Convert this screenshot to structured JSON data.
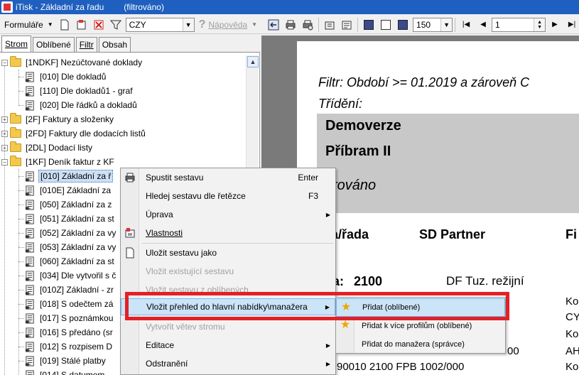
{
  "window": {
    "title": "iTisk - Základní za řadu",
    "filter_state": "(filtrováno)"
  },
  "toolbar": {
    "forms_label": "Formuláře",
    "currency_value": "CZY",
    "help_label": "Nápověda",
    "zoom_value": "150",
    "page_value": "1"
  },
  "tabs": [
    {
      "label": "Strom",
      "active": true
    },
    {
      "label": "Oblíbené",
      "active": false
    },
    {
      "label": "Filtr",
      "active": false
    },
    {
      "label": "Obsah",
      "active": false
    }
  ],
  "tree": {
    "items": [
      {
        "label": "[1NDKF]  Nezúčtované doklady",
        "kind": "folder",
        "level": 0,
        "expanded": true
      },
      {
        "label": "[010] Dle dokladů",
        "kind": "report",
        "level": 1
      },
      {
        "label": "[110] Dle dokladů1 - graf",
        "kind": "report",
        "level": 1
      },
      {
        "label": "[020] Dle řádků a dokladů",
        "kind": "report",
        "level": 1
      },
      {
        "label": "[2F]  Faktury a složenky",
        "kind": "folder",
        "level": 0,
        "expanded": false
      },
      {
        "label": "[2FD]  Faktury dle dodacích listů",
        "kind": "folder",
        "level": 0,
        "expanded": false
      },
      {
        "label": "[2DL]  Dodací listy",
        "kind": "folder",
        "level": 0,
        "expanded": false
      },
      {
        "label": "[1KF]  Deník faktur z KF",
        "kind": "folder",
        "level": 0,
        "expanded": true
      },
      {
        "label": "[010] Základní za ř",
        "kind": "report",
        "level": 1,
        "selected": true
      },
      {
        "label": "[010E] Základní za",
        "kind": "report",
        "level": 1
      },
      {
        "label": "[050] Základní za z",
        "kind": "report",
        "level": 1
      },
      {
        "label": "[051] Základní za st",
        "kind": "report",
        "level": 1
      },
      {
        "label": "[052] Základní za vy",
        "kind": "report",
        "level": 1
      },
      {
        "label": "[053] Základní za vy",
        "kind": "report",
        "level": 1
      },
      {
        "label": "[060] Základní za st",
        "kind": "report",
        "level": 1
      },
      {
        "label": "[034] Dle vytvořil s č",
        "kind": "report",
        "level": 1
      },
      {
        "label": "[010Z] Základní - zr",
        "kind": "report",
        "level": 1
      },
      {
        "label": "[018] S odečtem zá",
        "kind": "report",
        "level": 1
      },
      {
        "label": "[017] S poznámkou",
        "kind": "report",
        "level": 1
      },
      {
        "label": "[016] S předáno (sr",
        "kind": "report",
        "level": 1
      },
      {
        "label": "[012] S rozpisem D",
        "kind": "report",
        "level": 1
      },
      {
        "label": "[019] Stálé platby",
        "kind": "report",
        "level": 1
      },
      {
        "label": "[014] S datumem",
        "kind": "report",
        "level": 1
      }
    ]
  },
  "preview": {
    "filter_line": "Filtr:  Období >= 01.2019  a zároveň  C",
    "sort_line": "Třídění:",
    "company1": "Demoverze",
    "company2": "Příbram II",
    "filtered": "filtrováno",
    "col1": "ura/řada",
    "col2": "SD Partner",
    "col3": "Fi",
    "group_label": "a:",
    "group_value": "2100",
    "group_desc": "DF Tuz. režijní",
    "side_lines": [
      "Ko",
      "CY",
      "Ko",
      "AH",
      "Ko"
    ],
    "row_tail": "00",
    "bottom_row": "90010   2100   FPB  1002/000"
  },
  "context_menu": {
    "items": [
      {
        "label": "Spustit sestavu",
        "shortcut": "Enter",
        "icon": "printer-icon",
        "enabled": true
      },
      {
        "label": "Hledej sestavu dle řetězce",
        "shortcut": "F3",
        "enabled": true
      },
      {
        "label": "Úprava",
        "submenu": true,
        "enabled": true
      },
      {
        "label": "Vlastnosti",
        "icon": "properties-icon",
        "enabled": true
      },
      {
        "label": "Uložit sestavu jako",
        "icon": "document-icon",
        "enabled": true
      },
      {
        "label": "Vložit existující sestavu",
        "enabled": false
      },
      {
        "label": "Vložit sestavu z oblíbených",
        "enabled": false
      },
      {
        "label": "Vložit přehled do hlavní nabídky\\manažera",
        "submenu": true,
        "enabled": true,
        "highlighted": true
      },
      {
        "label": "Vytvořit větev stromu",
        "enabled": false
      },
      {
        "label": "Editace",
        "submenu": true,
        "enabled": true
      },
      {
        "label": "Odstranění",
        "submenu": true,
        "enabled": true
      }
    ]
  },
  "submenu": {
    "items": [
      {
        "label": "Přidat (oblíbené)",
        "icon": "star-icon",
        "highlighted": true
      },
      {
        "label": "Přidat k více profilům (oblíbené)",
        "icon": "star-icon"
      },
      {
        "label": "Přidat do manažera (správce)"
      }
    ]
  },
  "colors": {
    "titlebar": "#1f5fbf",
    "highlight_box": "#e32027",
    "menu_highlight": "#cce4f7"
  }
}
